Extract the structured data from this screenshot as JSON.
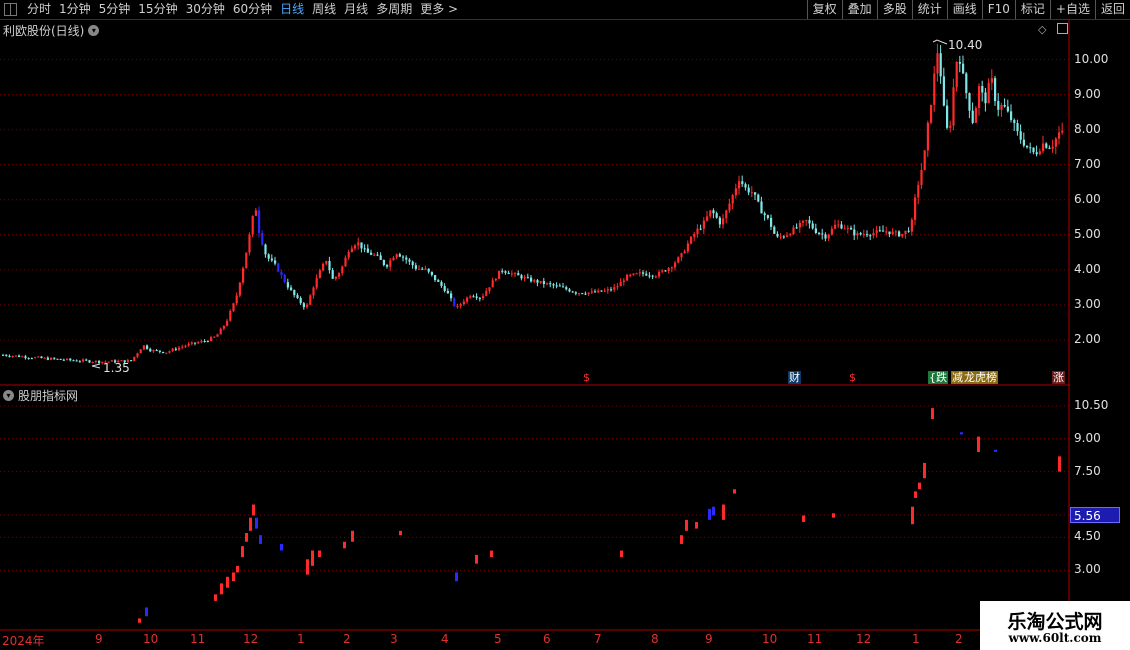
{
  "toolbar": {
    "left_items": [
      "分时",
      "1分钟",
      "5分钟",
      "15分钟",
      "30分钟",
      "60分钟",
      "日线",
      "周线",
      "月线",
      "多周期",
      "更多 >"
    ],
    "active_item": "日线",
    "right_items": [
      "复权",
      "叠加",
      "多股",
      "统计",
      "画线",
      "F10",
      "标记",
      "+自选",
      "返回"
    ]
  },
  "main_pane": {
    "title": "利欧股份(日线)",
    "y_ticks": [
      "10.00",
      "9.00",
      "8.00",
      "7.00",
      "6.00",
      "5.00",
      "4.00",
      "3.00",
      "2.00"
    ],
    "max_label": "10.40",
    "min_label": "1.35",
    "badges": [
      {
        "text": "$",
        "color": "#ff3030",
        "bg": "#000000"
      },
      {
        "text": "财",
        "color": "#ffffff",
        "bg": "#0a3a6a"
      },
      {
        "text": "$",
        "color": "#ff3030",
        "bg": "#000000"
      },
      {
        "text": "{跌",
        "color": "#ffffff",
        "bg": "#1a7a3a"
      },
      {
        "text": "减",
        "color": "#ffffff",
        "bg": "#8a6a10"
      },
      {
        "text": "龙虎榜",
        "color": "#ffffff",
        "bg": "#8a6a10"
      },
      {
        "text": "涨",
        "color": "#ffffff",
        "bg": "#6a1a1a"
      }
    ]
  },
  "sub_pane": {
    "title": "股朋指标网",
    "y_ticks": [
      "10.50",
      "9.00",
      "7.50",
      "4.50",
      "3.00"
    ],
    "price_marker": "5.56"
  },
  "time_axis": [
    "2024年",
    "9",
    "10",
    "11",
    "12",
    "1",
    "2",
    "3",
    "4",
    "5",
    "6",
    "7",
    "8",
    "9",
    "10",
    "11",
    "12",
    "1",
    "2"
  ],
  "watermark": {
    "title": "乐淘公式网",
    "url": "www.60lt.com"
  },
  "colors": {
    "up": "#ff2a2a",
    "down": "#7ee8e8",
    "blue": "#2a2aff",
    "grid": "#7a0000",
    "axis_line": "#b00000",
    "text": "#e0e0e0"
  },
  "chart_data": {
    "type": "candlestick",
    "title": "利欧股份(日线)",
    "ylim": [
      1.0,
      10.8
    ],
    "close_path": [
      [
        0,
        1.58
      ],
      [
        40,
        1.48
      ],
      [
        70,
        1.42
      ],
      [
        100,
        1.38
      ],
      [
        130,
        1.4
      ],
      [
        142,
        1.85
      ],
      [
        150,
        1.7
      ],
      [
        165,
        1.65
      ],
      [
        185,
        1.85
      ],
      [
        205,
        1.98
      ],
      [
        215,
        2.1
      ],
      [
        225,
        2.5
      ],
      [
        235,
        3.2
      ],
      [
        243,
        4.2
      ],
      [
        250,
        5.2
      ],
      [
        254,
        5.9
      ],
      [
        258,
        5.1
      ],
      [
        265,
        4.4
      ],
      [
        275,
        4.1
      ],
      [
        285,
        3.6
      ],
      [
        295,
        3.2
      ],
      [
        305,
        2.9
      ],
      [
        312,
        3.5
      ],
      [
        318,
        3.9
      ],
      [
        325,
        4.3
      ],
      [
        332,
        3.7
      ],
      [
        340,
        4.0
      ],
      [
        348,
        4.6
      ],
      [
        356,
        4.8
      ],
      [
        365,
        4.5
      ],
      [
        375,
        4.4
      ],
      [
        385,
        4.1
      ],
      [
        395,
        4.5
      ],
      [
        405,
        4.3
      ],
      [
        415,
        4.05
      ],
      [
        425,
        4.0
      ],
      [
        435,
        3.7
      ],
      [
        445,
        3.4
      ],
      [
        455,
        2.9
      ],
      [
        462,
        3.1
      ],
      [
        470,
        3.3
      ],
      [
        480,
        3.2
      ],
      [
        490,
        3.6
      ],
      [
        500,
        4.0
      ],
      [
        515,
        3.85
      ],
      [
        530,
        3.7
      ],
      [
        545,
        3.6
      ],
      [
        560,
        3.5
      ],
      [
        575,
        3.35
      ],
      [
        590,
        3.35
      ],
      [
        605,
        3.4
      ],
      [
        615,
        3.5
      ],
      [
        625,
        3.8
      ],
      [
        640,
        3.9
      ],
      [
        655,
        3.85
      ],
      [
        670,
        4.1
      ],
      [
        680,
        4.4
      ],
      [
        688,
        4.8
      ],
      [
        695,
        5.1
      ],
      [
        702,
        5.3
      ],
      [
        710,
        5.7
      ],
      [
        720,
        5.3
      ],
      [
        730,
        6.0
      ],
      [
        738,
        6.6
      ],
      [
        745,
        6.3
      ],
      [
        752,
        6.2
      ],
      [
        760,
        5.7
      ],
      [
        768,
        5.4
      ],
      [
        775,
        4.9
      ],
      [
        785,
        5.0
      ],
      [
        795,
        5.2
      ],
      [
        805,
        5.4
      ],
      [
        815,
        5.1
      ],
      [
        825,
        4.95
      ],
      [
        835,
        5.3
      ],
      [
        845,
        5.2
      ],
      [
        855,
        5.0
      ],
      [
        870,
        5.05
      ],
      [
        885,
        5.1
      ],
      [
        900,
        5.0
      ],
      [
        910,
        5.2
      ],
      [
        915,
        6.2
      ],
      [
        920,
        6.8
      ],
      [
        924,
        7.4
      ],
      [
        928,
        8.4
      ],
      [
        932,
        9.2
      ],
      [
        936,
        10.3
      ],
      [
        940,
        9.5
      ],
      [
        944,
        8.2
      ],
      [
        948,
        7.8
      ],
      [
        952,
        9.1
      ],
      [
        957,
        10.3
      ],
      [
        962,
        9.5
      ],
      [
        967,
        8.8
      ],
      [
        972,
        8.2
      ],
      [
        978,
        9.2
      ],
      [
        984,
        8.8
      ],
      [
        990,
        9.5
      ],
      [
        996,
        8.6
      ],
      [
        1002,
        8.7
      ],
      [
        1010,
        8.3
      ],
      [
        1018,
        7.8
      ],
      [
        1026,
        7.5
      ],
      [
        1034,
        7.3
      ],
      [
        1042,
        7.6
      ],
      [
        1050,
        7.5
      ],
      [
        1058,
        7.9
      ]
    ],
    "sub_segments": [
      [
        138,
        0.8,
        0.6,
        "red"
      ],
      [
        145,
        1.3,
        0.9,
        "blue"
      ],
      [
        214,
        1.9,
        1.6,
        "red"
      ],
      [
        220,
        2.4,
        1.9,
        "red"
      ],
      [
        226,
        2.7,
        2.2,
        "red"
      ],
      [
        232,
        2.9,
        2.5,
        "red"
      ],
      [
        236,
        3.2,
        2.9,
        "red"
      ],
      [
        241,
        4.1,
        3.6,
        "red"
      ],
      [
        245,
        4.7,
        4.3,
        "red"
      ],
      [
        249,
        5.4,
        4.8,
        "red"
      ],
      [
        252,
        6.0,
        5.5,
        "red"
      ],
      [
        255,
        5.4,
        4.9,
        "blue"
      ],
      [
        259,
        4.6,
        4.2,
        "blue"
      ],
      [
        280,
        4.2,
        3.9,
        "blue"
      ],
      [
        306,
        3.5,
        2.8,
        "red"
      ],
      [
        311,
        3.9,
        3.2,
        "red"
      ],
      [
        318,
        3.9,
        3.6,
        "red"
      ],
      [
        343,
        4.3,
        4.0,
        "red"
      ],
      [
        351,
        4.8,
        4.3,
        "red"
      ],
      [
        399,
        4.8,
        4.6,
        "red"
      ],
      [
        455,
        2.9,
        2.5,
        "blue"
      ],
      [
        475,
        3.7,
        3.3,
        "red"
      ],
      [
        490,
        3.9,
        3.6,
        "red"
      ],
      [
        620,
        3.9,
        3.6,
        "red"
      ],
      [
        680,
        4.6,
        4.2,
        "red"
      ],
      [
        685,
        5.3,
        4.8,
        "red"
      ],
      [
        695,
        5.2,
        4.9,
        "red"
      ],
      [
        708,
        5.8,
        5.3,
        "blue"
      ],
      [
        712,
        5.9,
        5.5,
        "blue"
      ],
      [
        722,
        6.0,
        5.3,
        "red"
      ],
      [
        733,
        6.7,
        6.5,
        "red"
      ],
      [
        802,
        5.5,
        5.2,
        "red"
      ],
      [
        832,
        5.6,
        5.4,
        "red"
      ],
      [
        911,
        5.9,
        5.1,
        "red"
      ],
      [
        914,
        6.6,
        6.3,
        "red"
      ],
      [
        918,
        7.0,
        6.7,
        "red"
      ],
      [
        923,
        7.9,
        7.2,
        "red"
      ],
      [
        931,
        10.4,
        9.9,
        "red"
      ],
      [
        960,
        9.3,
        9.2,
        "blue"
      ],
      [
        977,
        9.1,
        8.4,
        "red"
      ],
      [
        994,
        8.5,
        8.4,
        "blue"
      ],
      [
        1058,
        8.2,
        7.5,
        "red"
      ]
    ]
  }
}
